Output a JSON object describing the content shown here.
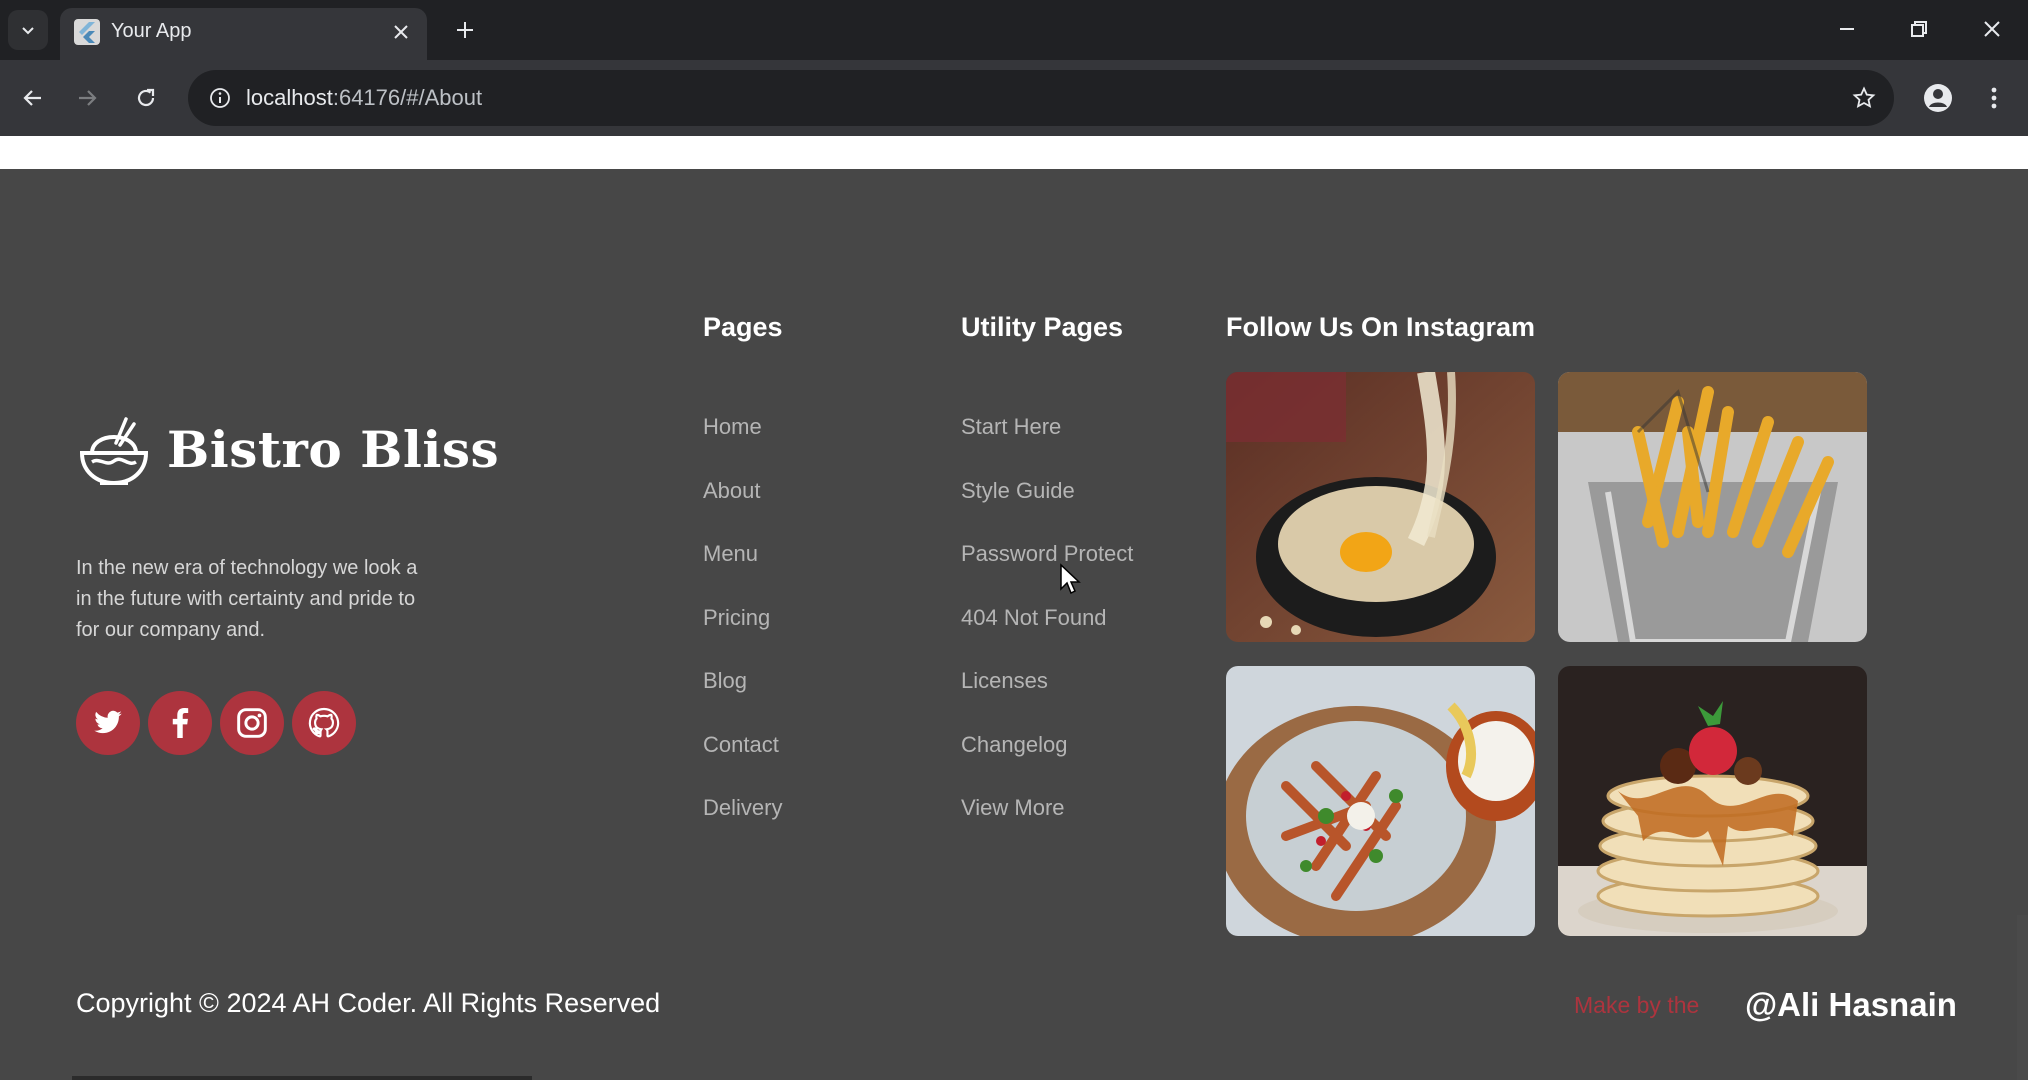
{
  "browser": {
    "tab_title": "Your App",
    "url_host": "localhost",
    "url_rest": ":64176/#/About"
  },
  "footer": {
    "brand": "Bistro Bliss",
    "description": "In the new era of technology we look a\nin the future with certainty and pride to\n for our company and.",
    "socials": [
      {
        "icon": "twitter-icon"
      },
      {
        "icon": "facebook-icon"
      },
      {
        "icon": "instagram-icon"
      },
      {
        "icon": "github-icon"
      }
    ],
    "pages": {
      "title": "Pages",
      "links": [
        "Home",
        "About",
        "Menu",
        "Pricing",
        "Blog",
        "Contact",
        "Delivery"
      ]
    },
    "utility": {
      "title": "Utility Pages",
      "links": [
        "Start Here",
        "Style Guide",
        "Password Protect",
        "404 Not Found",
        "Licenses",
        "Changelog",
        "View More"
      ]
    },
    "instagram": {
      "title": "Follow Us On Instagram",
      "photos": [
        "cheesy-egg-bowl-photo",
        "french-fries-photo",
        "loaded-fries-salad-photo",
        "pancake-stack-photo"
      ]
    },
    "copyright": "Copyright © 2024 AH Coder. All Rights Reserved",
    "made_by": "Make by the",
    "handle": "@Ali Hasnain"
  },
  "colors": {
    "accent": "#ad343e",
    "footer_bg": "#474747",
    "browser_bg": "#202124"
  }
}
